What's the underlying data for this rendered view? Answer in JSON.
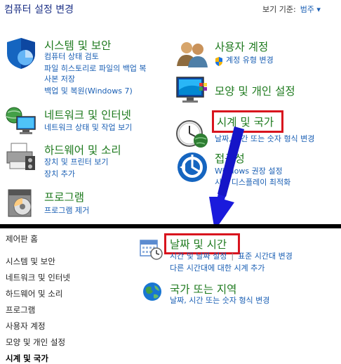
{
  "top": {
    "title": "컴퓨터 설정 변경",
    "view_by_label": "보기 기준:",
    "view_by_value": "범주 ▾"
  },
  "categories": {
    "system": {
      "title": "시스템 및 보안",
      "links": [
        "컴퓨터 상태 검토",
        "파일 히스토리로 파일의 백업 복",
        "사본 저장",
        "백업 및 복원(Windows 7)"
      ]
    },
    "network": {
      "title": "네트워크 및 인터넷",
      "links": [
        "네트워크 상태 및 작업 보기"
      ]
    },
    "hardware": {
      "title": "하드웨어 및 소리",
      "links": [
        "장치 및 프린터 보기",
        "장치 추가"
      ]
    },
    "programs": {
      "title": "프로그램",
      "links": [
        "프로그램 제거"
      ]
    },
    "user": {
      "title": "사용자 계정",
      "links": [
        "계정 유형 변경"
      ]
    },
    "appearance": {
      "title": "모양 및 개인 설정"
    },
    "clock": {
      "title": "시계 및 국가",
      "links": [
        "날짜, 시간 또는 숫자 형식 변경"
      ]
    },
    "ease": {
      "title": "접근성",
      "links": [
        "Windows 권장 설정",
        "시각 디스플레이 최적화"
      ]
    }
  },
  "bottom": {
    "nav": [
      "제어판 홈",
      "시스템 및 보안",
      "네트워크 및 인터넷",
      "하드웨어 및 소리",
      "프로그램",
      "사용자 계정",
      "모양 및 개인 설정",
      "시계 및 국가"
    ],
    "datetime": {
      "title": "날짜 및 시간",
      "links": [
        "시간 및 날짜 설정",
        "표준 시간대 변경",
        "다른 시간대에 대한 시계 추가"
      ]
    },
    "region": {
      "title": "국가 또는 지역",
      "links": [
        "날짜, 시간 또는 숫자 형식 변경"
      ]
    }
  },
  "colors": {
    "highlight": "#d8141e",
    "arrow": "#1a1adc",
    "category": "#1e7a1e",
    "link": "#1a5fb4"
  }
}
